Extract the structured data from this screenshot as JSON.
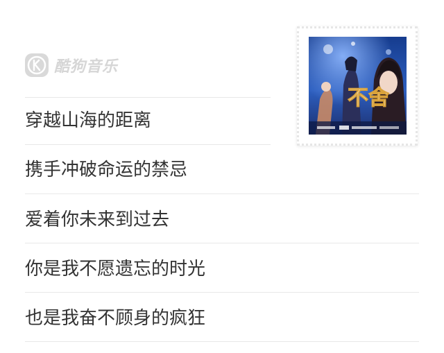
{
  "brand": {
    "icon": "kugou-k-logo-icon",
    "name": "酷狗音乐"
  },
  "lyrics": [
    "穿越山海的距离",
    "携手冲破命运的禁忌",
    "爱着你未来到过去",
    "你是我不愿遗忘的时光",
    "也是我奋不顾身的疯狂"
  ],
  "album_cover": {
    "title_text": "不舍"
  },
  "colors": {
    "lyric_text": "#333333",
    "brand_gray": "#d6d6d6",
    "divider": "#e8e8e8"
  }
}
